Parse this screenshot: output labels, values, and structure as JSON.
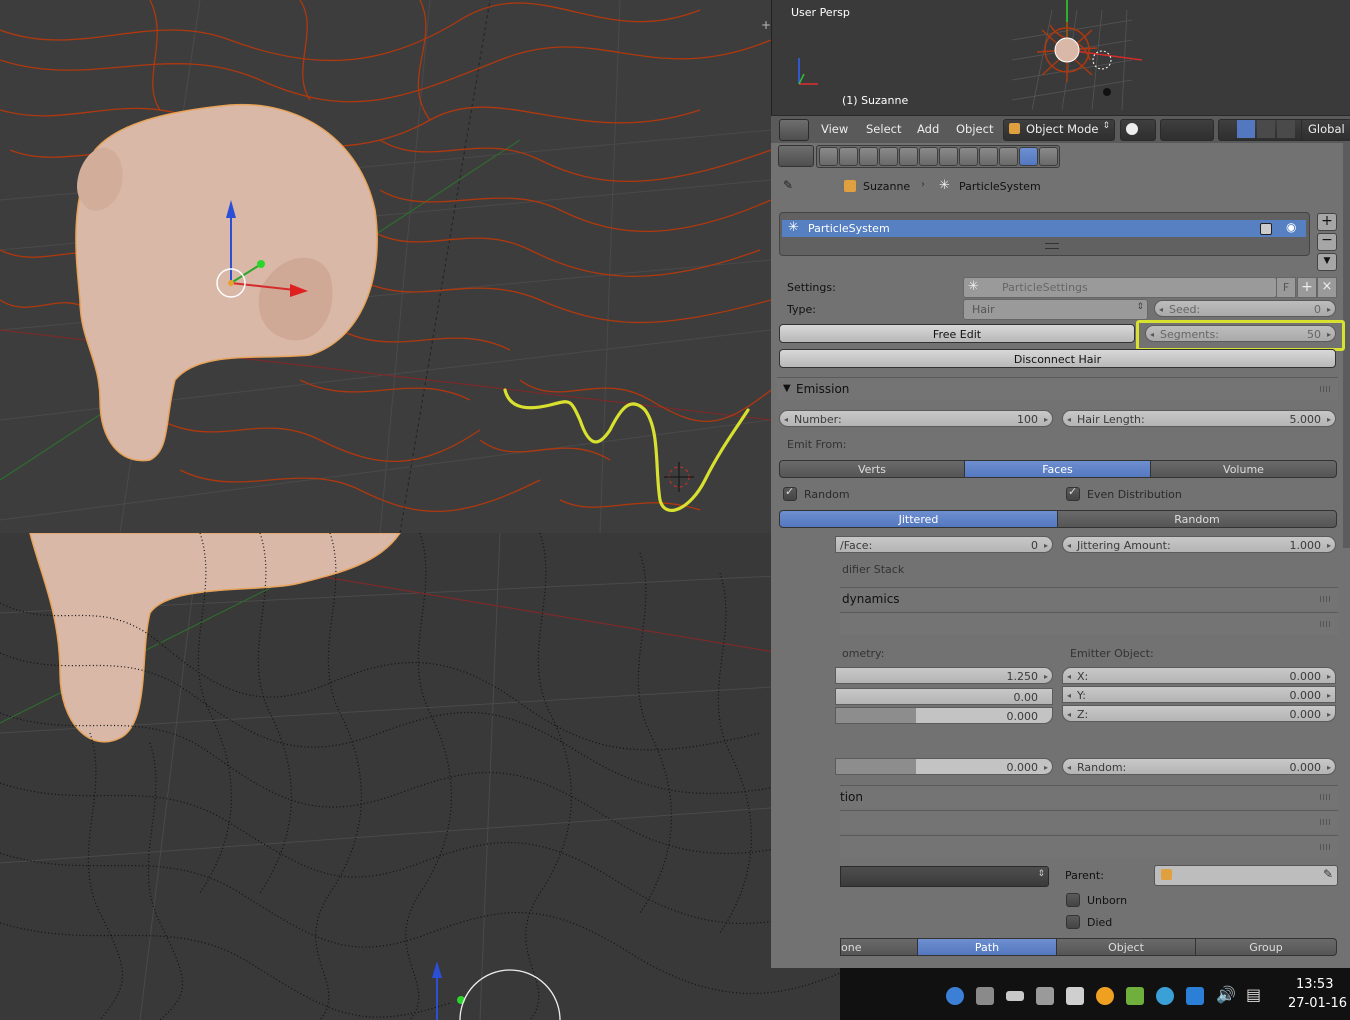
{
  "mini_viewport": {
    "label": "User Persp",
    "object_label": "(1) Suzanne"
  },
  "view3d_header": {
    "menu": [
      "View",
      "Select",
      "Add",
      "Object"
    ],
    "mode": "Object Mode",
    "orientation": "Global"
  },
  "breadcrumb": {
    "object": "Suzanne",
    "particle_system": "ParticleSystem"
  },
  "particle_list": {
    "item": "ParticleSystem"
  },
  "settings": {
    "settings_label": "Settings:",
    "settings_value": "ParticleSettings",
    "fake_user": "F",
    "type_label": "Type:",
    "type_value": "Hair",
    "seed_label": "Seed:",
    "seed_value": "0",
    "free_edit": "Free Edit",
    "segments_label": "Segments:",
    "segments_value": "50",
    "disconnect_hair": "Disconnect Hair"
  },
  "emission": {
    "title": "Emission",
    "number_label": "Number:",
    "number_value": "100",
    "hair_length_label": "Hair Length:",
    "hair_length_value": "5.000",
    "emit_from_label": "Emit From:",
    "emit_from_options": [
      "Verts",
      "Faces",
      "Volume"
    ],
    "emit_from_selected": "Faces",
    "random_label": "Random",
    "even_distribution_label": "Even Distribution",
    "distribution_options": [
      "Jittered",
      "Random"
    ],
    "distribution_selected": "Jittered",
    "per_face_label": "/Face:",
    "per_face_value": "0",
    "jittering_label": "Jittering Amount:",
    "jittering_value": "1.000"
  },
  "partial_panels": {
    "modifier_stack": "difier Stack",
    "dynamics": "dynamics",
    "geometry_label": "ometry:",
    "emitter_object_label": "Emitter Object:",
    "geom_val1": "1.250",
    "geom_val2": "0.00",
    "geom_val3": "0.000",
    "x_label": "X:",
    "x_value": "0.000",
    "y_label": "Y:",
    "y_value": "0.000",
    "z_label": "Z:",
    "z_value": "0.000",
    "left_val4": "0.000",
    "random_label": "Random:",
    "random_value": "0.000",
    "rotation_fragment": "tion",
    "parent_label": "Parent:",
    "unborn_label": "Unborn",
    "died_label": "Died",
    "render_options": [
      "one",
      "Path",
      "Object",
      "Group"
    ],
    "render_selected": "Path"
  },
  "taskbar": {
    "time": "13:53",
    "date": "27-01-16"
  },
  "colors": {
    "selection_blue": "#5680c2",
    "highlight_yellow": "#d8e030",
    "hair_red": "#b0380e"
  }
}
